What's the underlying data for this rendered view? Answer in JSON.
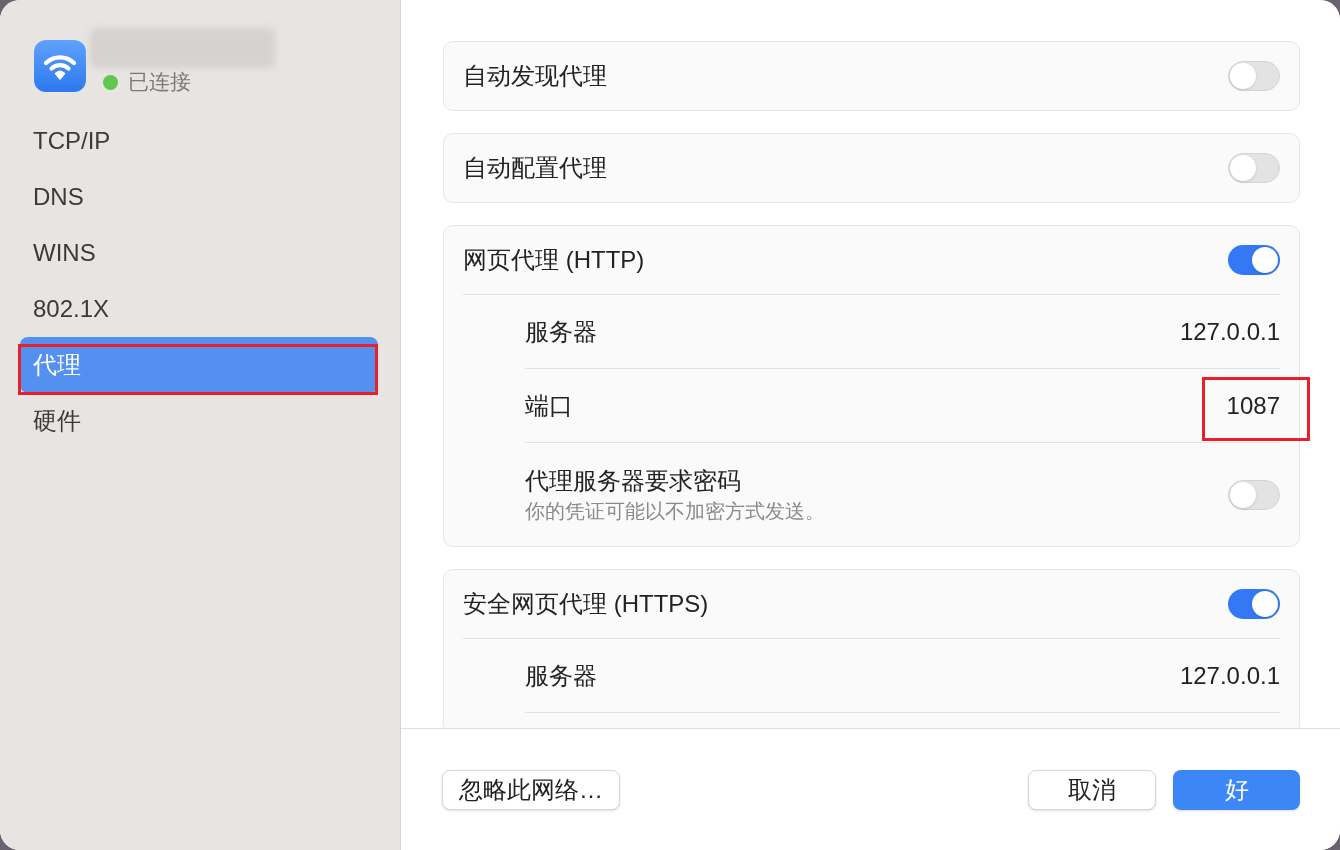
{
  "sidebar": {
    "network": {
      "status": "已连接",
      "connected": true
    },
    "items": [
      {
        "label": "TCP/IP",
        "selected": false,
        "highlighted": false
      },
      {
        "label": "DNS",
        "selected": false,
        "highlighted": false
      },
      {
        "label": "WINS",
        "selected": false,
        "highlighted": false
      },
      {
        "label": "802.1X",
        "selected": false,
        "highlighted": false
      },
      {
        "label": "代理",
        "selected": true,
        "highlighted": true
      },
      {
        "label": "硬件",
        "selected": false,
        "highlighted": false
      }
    ]
  },
  "sections": [
    {
      "title": "自动发现代理",
      "on": false
    },
    {
      "title": "自动配置代理",
      "on": false
    },
    {
      "title": "网页代理 (HTTP)",
      "on": true,
      "clipped": false,
      "rows": [
        {
          "kind": "value",
          "label": "服务器",
          "value": "127.0.0.1",
          "highlighted": false
        },
        {
          "kind": "value",
          "label": "端口",
          "value": "1087",
          "highlighted": true
        },
        {
          "kind": "toggle",
          "label": "代理服务器要求密码",
          "note": "你的凭证可能以不加密方式发送。",
          "on": false
        }
      ]
    },
    {
      "title": "安全网页代理 (HTTPS)",
      "on": true,
      "clipped": true,
      "rows": [
        {
          "kind": "value",
          "label": "服务器",
          "value": "127.0.0.1",
          "highlighted": false
        }
      ]
    }
  ],
  "buttons": [
    {
      "label": "忽略此网络…",
      "kind": "secondary"
    },
    {
      "label": "取消",
      "kind": "secondary"
    },
    {
      "label": "好",
      "kind": "primary"
    }
  ]
}
